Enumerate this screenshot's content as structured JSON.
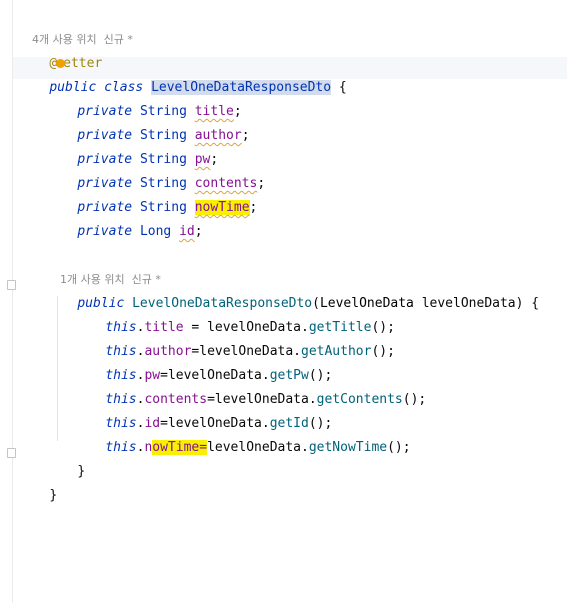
{
  "usage_hints": {
    "class_usages": "4개 사용 위치",
    "class_author": "신규 *",
    "ctor_usages": "1개 사용 위치",
    "ctor_author": "신규 *"
  },
  "annotation": {
    "at": "@",
    "bulb_icon": "lightbulb-icon",
    "rest": "etter"
  },
  "class_decl": {
    "modifiers": "public class ",
    "name": "LevelOneDataResponseDto",
    "brace": " {"
  },
  "fields": [
    {
      "modifier": "private",
      "type": "String",
      "name": "title"
    },
    {
      "modifier": "private",
      "type": "String",
      "name": "author"
    },
    {
      "modifier": "private",
      "type": "String",
      "name": "pw"
    },
    {
      "modifier": "private",
      "type": "String",
      "name": "contents"
    },
    {
      "modifier": "private",
      "type": "String",
      "name": "nowTime"
    },
    {
      "modifier": "private",
      "type": "Long",
      "name": "id"
    }
  ],
  "constructor": {
    "modifier": "public",
    "name": "LevelOneDataResponseDto",
    "param_type": "LevelOneData",
    "param_name": "levelOneData",
    "open": ") {",
    "close": "}"
  },
  "assignments": [
    {
      "this": "this",
      "field": "title",
      "eq": " = ",
      "obj": "levelOneData",
      "getter": "getTitle",
      "tail": "();"
    },
    {
      "this": "this",
      "field": "author",
      "eq": "=",
      "obj": "levelOneData",
      "getter": "getAuthor",
      "tail": "();"
    },
    {
      "this": "this",
      "field": "pw",
      "eq": "=",
      "obj": "levelOneData",
      "getter": "getPw",
      "tail": "();"
    },
    {
      "this": "this",
      "field": "contents",
      "eq": "=",
      "obj": "levelOneData",
      "getter": "getContents",
      "tail": "();"
    },
    {
      "this": "this",
      "field": "id",
      "eq": "=",
      "obj": "levelOneData",
      "getter": "getId",
      "tail": "();"
    },
    {
      "this": "this",
      "field_pre": "n",
      "field_hl": "owTime=",
      "obj": "levelOneData",
      "getter": "getNowTime",
      "tail": "();"
    }
  ],
  "class_close": "}",
  "colors": {
    "keyword": "#0033b3",
    "field": "#871094",
    "method": "#00627a",
    "annotation": "#9e880d",
    "selection": "#d3dced",
    "search_highlight": "#f9f000",
    "hint": "#8c8c8c"
  }
}
